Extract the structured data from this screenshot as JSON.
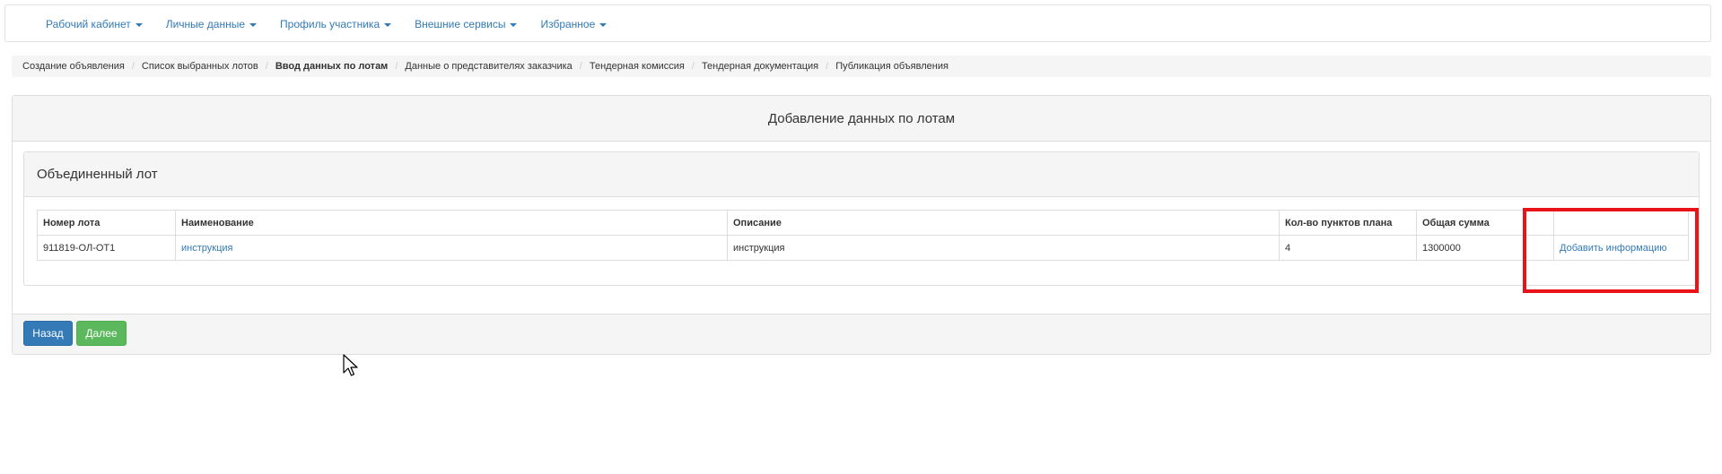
{
  "navbar": {
    "items": [
      {
        "label": "Рабочий кабинет"
      },
      {
        "label": "Личные данные"
      },
      {
        "label": "Профиль участника"
      },
      {
        "label": "Внешние сервисы"
      },
      {
        "label": "Избранное"
      }
    ]
  },
  "breadcrumb": {
    "items": [
      {
        "label": "Создание объявления"
      },
      {
        "label": "Список выбранных лотов"
      },
      {
        "label": "Ввод данных по лотам",
        "active": true
      },
      {
        "label": "Данные о представителях заказчика"
      },
      {
        "label": "Тендерная комиссия"
      },
      {
        "label": "Тендерная документация"
      },
      {
        "label": "Публикация объявления"
      }
    ],
    "separator": "/"
  },
  "panel": {
    "title": "Добавление данных по лотам",
    "inner_title": "Объединенный лот",
    "table": {
      "headers": [
        "Номер лота",
        "Наименование",
        "Описание",
        "Кол-во пунктов плана",
        "Общая сумма",
        ""
      ],
      "rows": [
        {
          "lot_number": "911819-ОЛ-ОТ1",
          "name": "инструкция",
          "description": "инструкция",
          "plan_items": "4",
          "total": "1300000",
          "action": "Добавить информацию"
        }
      ]
    },
    "buttons": {
      "back": "Назад",
      "next": "Далее"
    }
  },
  "colors": {
    "link": "#337ab7",
    "primary": "#337ab7",
    "success": "#5cb85c",
    "highlight": "#e8141a"
  },
  "icons": {
    "caret": "caret-down-icon",
    "cursor": "mouse-cursor-icon"
  }
}
